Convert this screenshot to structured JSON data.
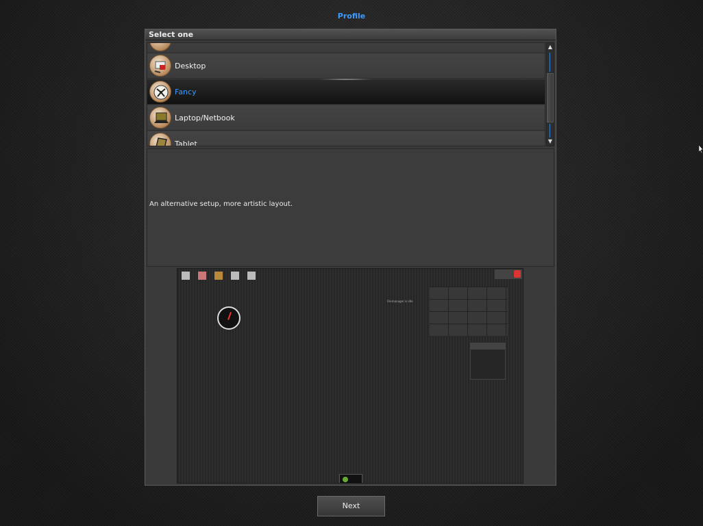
{
  "page": {
    "title": "Profile"
  },
  "panel": {
    "header": "Select one",
    "items": [
      {
        "label": "",
        "icon": "partial-profile-icon"
      },
      {
        "label": "Desktop",
        "icon": "desktop-profile-icon"
      },
      {
        "label": "Fancy",
        "icon": "fancy-profile-icon",
        "selected": true
      },
      {
        "label": "Laptop/Netbook",
        "icon": "laptop-profile-icon"
      },
      {
        "label": "Tablet",
        "icon": "tablet-profile-icon"
      }
    ],
    "description": "An alternative setup, more artistic layout.",
    "preview": {
      "window_text": "Filemanager is idle"
    }
  },
  "footer": {
    "next_label": "Next"
  },
  "colors": {
    "accent": "#3d9bff",
    "panel": "#3a3a3a",
    "selected_bg": "#1a1a1a"
  }
}
